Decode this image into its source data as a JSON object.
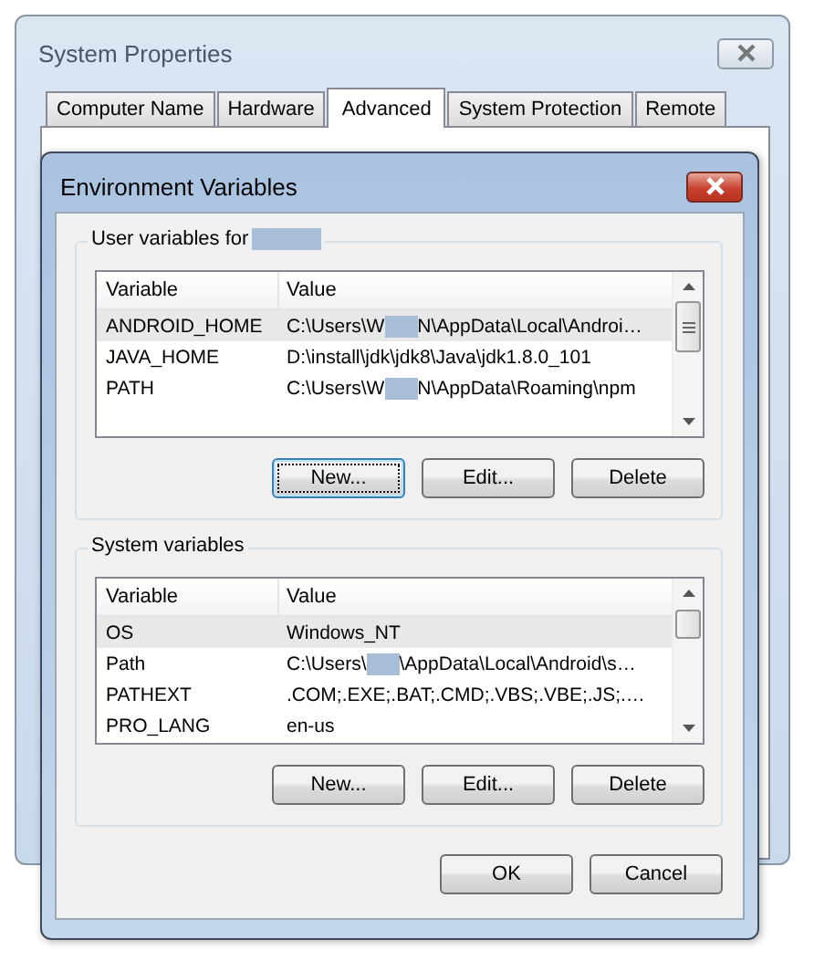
{
  "window": {
    "title": "System Properties"
  },
  "tabs": [
    {
      "label": "Computer Name",
      "selected": false
    },
    {
      "label": "Hardware",
      "selected": false
    },
    {
      "label": "Advanced",
      "selected": true
    },
    {
      "label": "System Protection",
      "selected": false
    },
    {
      "label": "Remote",
      "selected": false
    }
  ],
  "dialog": {
    "title": "Environment Variables",
    "user_variables": {
      "label": "User variables for",
      "redacted": true,
      "columns": [
        "Variable",
        "Value"
      ],
      "rows": [
        {
          "variable": "ANDROID_HOME",
          "value": "C:\\Users\\W",
          "redacted": true,
          "value_end": "N\\AppData\\Local\\Androi…",
          "selected": true
        },
        {
          "variable": "JAVA_HOME",
          "value": "D:\\install\\jdk\\jdk8\\Java\\jdk1.8.0_101",
          "redacted": false,
          "selected": false
        },
        {
          "variable": "PATH",
          "value": "C:\\Users\\W",
          "redacted": true,
          "value_end": "N\\AppData\\Roaming\\npm",
          "selected": false
        }
      ],
      "buttons": [
        {
          "label": "New...",
          "default": true
        },
        {
          "label": "Edit...",
          "default": false
        },
        {
          "label": "Delete",
          "default": false
        }
      ]
    },
    "system_variables": {
      "label": "System variables",
      "columns": [
        "Variable",
        "Value"
      ],
      "rows": [
        {
          "variable": "OS",
          "value": "Windows_NT",
          "redacted": false,
          "selected": true
        },
        {
          "variable": "Path",
          "value": "C:\\Users\\",
          "redacted": true,
          "value_end": "\\AppData\\Local\\Android\\s…",
          "selected": false
        },
        {
          "variable": "PATHEXT",
          "value": ".COM;.EXE;.BAT;.CMD;.VBS;.VBE;.JS;.…",
          "redacted": false,
          "selected": false
        },
        {
          "variable": "PRO_LANG",
          "value": "en-us",
          "redacted": false,
          "selected": false
        }
      ],
      "buttons": [
        {
          "label": "New...",
          "default": false
        },
        {
          "label": "Edit...",
          "default": false
        },
        {
          "label": "Delete",
          "default": false
        }
      ]
    },
    "buttons": [
      "OK",
      "Cancel"
    ]
  }
}
